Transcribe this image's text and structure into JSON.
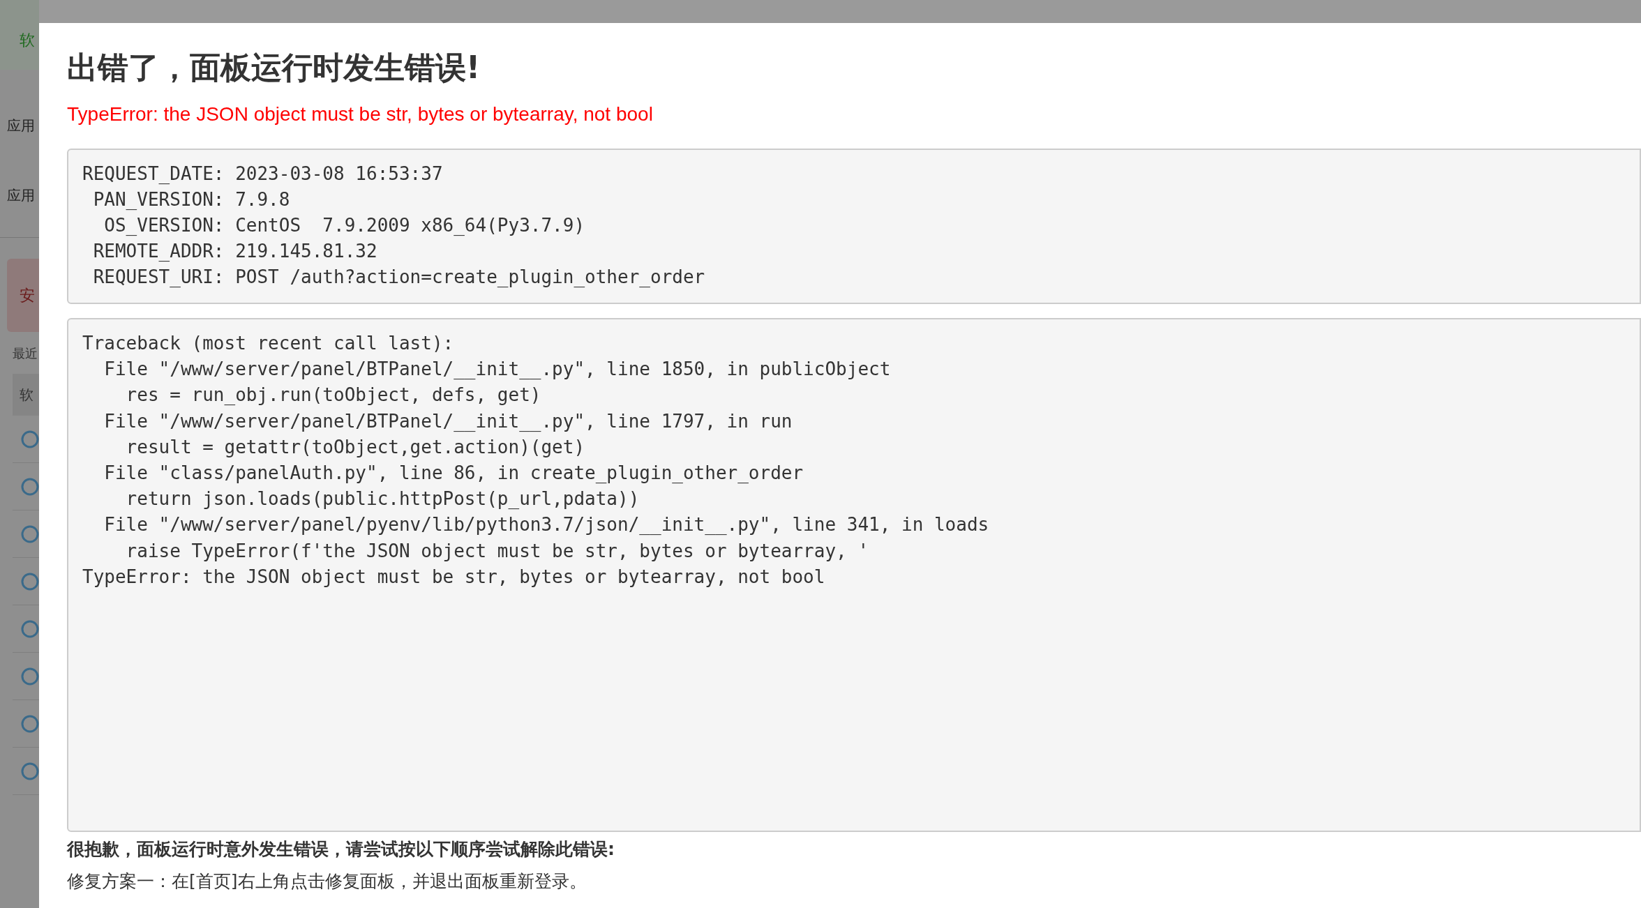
{
  "background": {
    "header_text": "软",
    "menu_items": [
      "应用",
      "应用"
    ],
    "button_text": "安",
    "section_label": "最近",
    "table_header": "软"
  },
  "dialog": {
    "title": "出错了，面板运行时发生错误!",
    "error_message": "TypeError: the JSON object must be str, bytes or bytearray, not bool",
    "request_info": [
      "REQUEST_DATE: 2023-03-08 16:53:37",
      " PAN_VERSION: 7.9.8",
      "  OS_VERSION: CentOS  7.9.2009 x86_64(Py3.7.9)",
      " REMOTE_ADDR: 219.145.81.32",
      " REQUEST_URI: POST /auth?action=create_plugin_other_order"
    ],
    "traceback": [
      "Traceback (most recent call last):",
      "  File \"/www/server/panel/BTPanel/__init__.py\", line 1850, in publicObject",
      "    res = run_obj.run(toObject, defs, get)",
      "  File \"/www/server/panel/BTPanel/__init__.py\", line 1797, in run",
      "    result = getattr(toObject,get.action)(get)",
      "  File \"class/panelAuth.py\", line 86, in create_plugin_other_order",
      "    return json.loads(public.httpPost(p_url,pdata))",
      "  File \"/www/server/panel/pyenv/lib/python3.7/json/__init__.py\", line 341, in loads",
      "    raise TypeError(f'the JSON object must be str, bytes or bytearray, '",
      "TypeError: the JSON object must be str, bytes or bytearray, not bool"
    ],
    "apology": "很抱歉，面板运行时意外发生错误，请尝试按以下顺序尝试解除此错误:",
    "fix_steps": [
      "修复方案一：在[首页]右上角点击修复面板，并退出面板重新登录。"
    ]
  }
}
